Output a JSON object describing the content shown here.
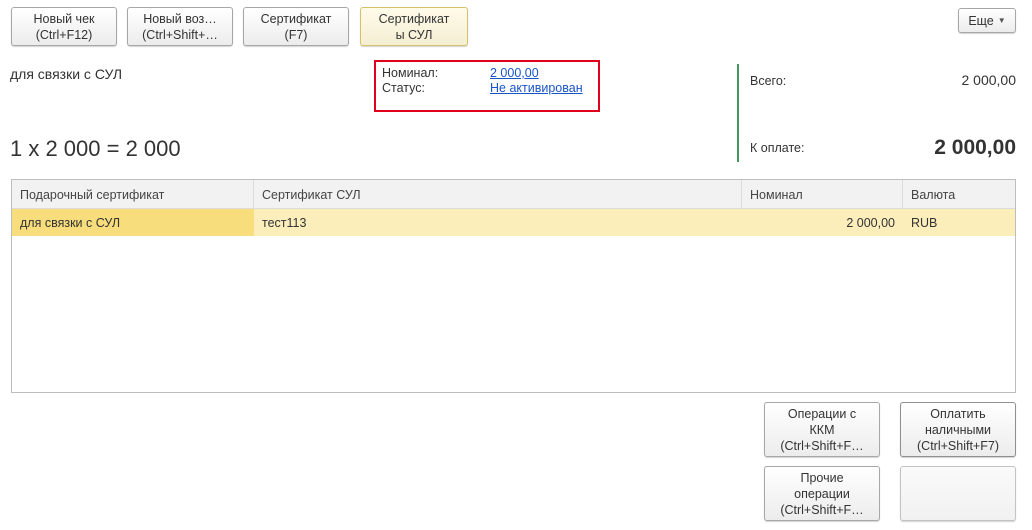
{
  "toolbar": {
    "new_receipt": [
      "Новый чек",
      "(Ctrl+F12)"
    ],
    "new_return": [
      "Новый воз…",
      "(Ctrl+Shift+…"
    ],
    "certificate": [
      "Сертификат",
      "(F7)"
    ],
    "certificates_sul": [
      "Сертификат",
      "ы СУЛ"
    ],
    "more_label": "Еще"
  },
  "certificate": {
    "title": "для связки с СУЛ",
    "formula": "1 x 2 000 = 2 000"
  },
  "info": {
    "nominal_label": "Номинал:",
    "nominal_value": "2 000,00",
    "status_label": "Статус:",
    "status_value": "Не активирован"
  },
  "summary": {
    "total_label": "Всего:",
    "total_value": "2 000,00",
    "to_pay_label": "К оплате:",
    "to_pay_value": "2 000,00"
  },
  "table": {
    "columns": [
      "Подарочный сертификат",
      "Сертификат СУЛ",
      "Номинал",
      "Валюта"
    ],
    "rows": [
      [
        "для связки с СУЛ",
        "тест113",
        "2 000,00",
        "RUB"
      ]
    ]
  },
  "actions": {
    "kkm_operations": [
      "Операции с",
      "ККМ",
      "(Ctrl+Shift+F…"
    ],
    "pay_cash": [
      "Оплатить",
      "наличными",
      "(Ctrl+Shift+F7)"
    ],
    "other_operations": [
      "Прочие",
      "операции",
      "(Ctrl+Shift+F…"
    ]
  },
  "colors": {
    "status_link": "#1a55c7",
    "highlight_box": "#e0001b",
    "divider": "#3f9a5c",
    "row_highlight": "#fbeebb",
    "cell_selected": "#f7dd7c"
  }
}
